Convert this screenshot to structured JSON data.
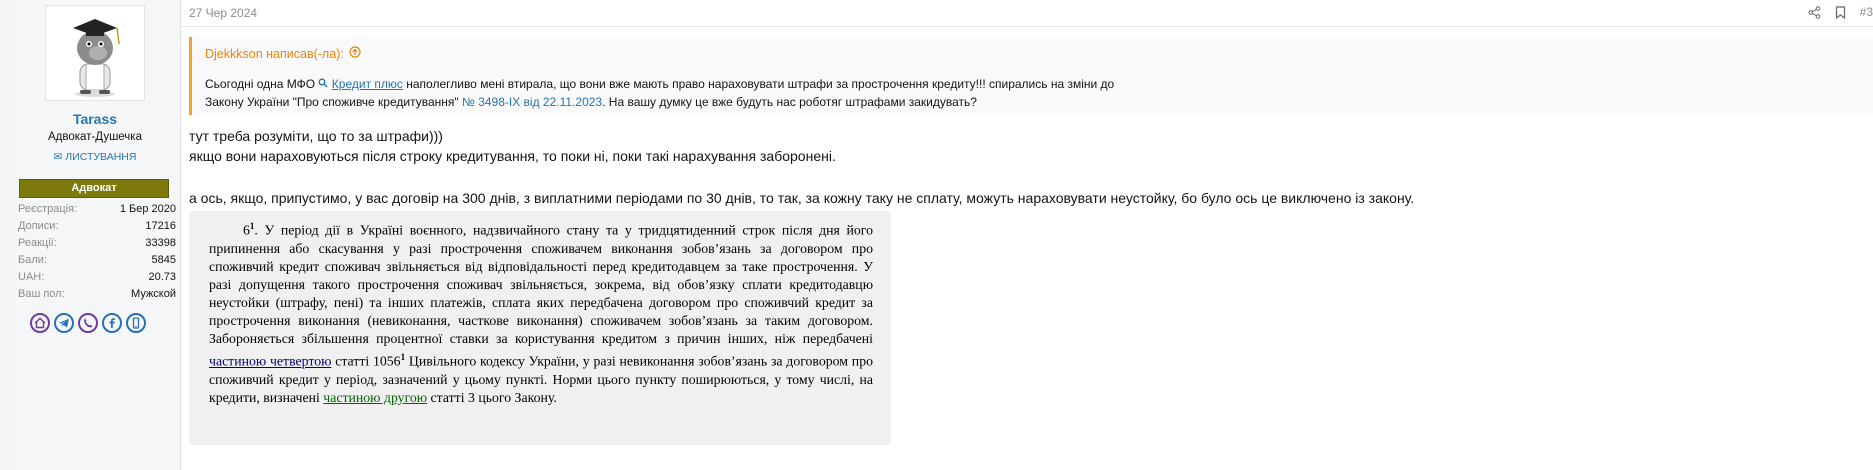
{
  "post": {
    "date": "27 Чер 2024",
    "post_number": "#3"
  },
  "user": {
    "name": "Tarass",
    "title": "Адвокат-Душечка",
    "listing_label": "ЛИСТУВАННЯ",
    "badge": "Адвокат",
    "stats": [
      {
        "label": "Реєстрація:",
        "value": "1 Бер 2020"
      },
      {
        "label": "Дописи:",
        "value": "17216"
      },
      {
        "label": "Реакції:",
        "value": "33398"
      },
      {
        "label": "Бали:",
        "value": "5845"
      },
      {
        "label": "UAH:",
        "value": "20.73"
      },
      {
        "label": "Ваш пол:",
        "value": "Мужской"
      }
    ],
    "social_icons": [
      "home-icon",
      "telegram-icon",
      "viber-icon",
      "facebook-icon",
      "phone-icon"
    ]
  },
  "quote": {
    "author_line": "Djekkkson написав(-ла):",
    "l1_a": "Сьогодні одна МФО ",
    "l1_link": "Кредит плюс",
    "l1_b": " наполегливо мені втирала, що вони вже мають право нараховувати штрафи за прострочення кредиту!!! спирались на зміни до",
    "l2_a": "Закону України \"Про споживче кредитування\" ",
    "l2_link": "№ 3498-IX від 22.11.2023",
    "l2_b": ". На вашу думку це вже будуть нас роботяг штрафами закидувать?"
  },
  "message": {
    "line1": "тут треба розуміти, що то за штрафи)))",
    "line2": "якщо вони нараховуються після строку кредитування, то поки ні, поки такі нарахування заборонені.",
    "line3": "а ось, якщо, припустимо, у вас договір на 300 днів, з виплатними періодами по 30 днів, то так, за кожну таку не сплату, можуть нараховувати неустойку, бо було ось це виключено із закону."
  },
  "law": {
    "num": "6",
    "sup1": "1",
    "part1": ". У період дії в Україні воєнного, надзвичайного стану та у тридцятиденний строк після дня його припинення або скасування у разі прострочення споживачем виконання зобов’язань за договором про споживчий кредит споживач звільняється від відповідальності перед кредитодавцем за таке прострочення. У разі допущення такого прострочення споживач звільняється, зокрема, від обов’язку сплати кредитодавцю неустойки (штрафу, пені) та інших платежів, сплата яких передбачена договором про споживчий кредит за прострочення виконання (невиконання, часткове виконання) споживачем зобов’язань за таким договором. Забороняється збільшення процентної ставки за користування кредитом з причин інших, ніж передбачені ",
    "link1": "частиною четвертою",
    "part2": " статті 1056",
    "sup2": "1",
    "part3": " Цивільного кодексу України, у разі невиконання зобов’язань за договором про споживчий кредит у період, зазначений у цьому пункті. Норми цього пункту поширюються, у тому числі, на кредити, визначені ",
    "link2": "частиною другою",
    "part4": " статті 3 цього Закону."
  }
}
